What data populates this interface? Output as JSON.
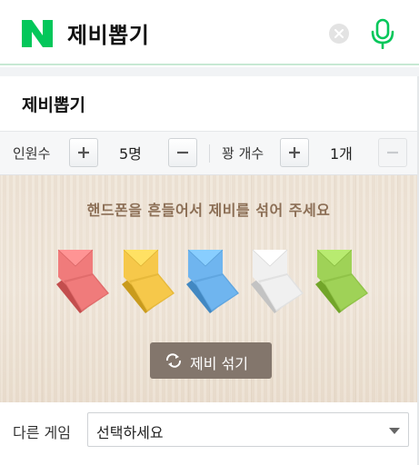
{
  "search": {
    "query": "제비뽑기",
    "logo_icon": "naver-n-logo",
    "logo_color": "#03c75a",
    "clear_icon": "clear-circle-icon",
    "mic_icon": "microphone-icon"
  },
  "widget": {
    "title": "제비뽑기",
    "participants": {
      "label": "인원수",
      "value": "5명"
    },
    "winners": {
      "label": "꽝 개수",
      "value": "1개"
    },
    "instruction": "핸드폰을 흔들어서 제비를 섞어 주세요",
    "tickets": [
      {
        "color": "#f07b7b"
      },
      {
        "color": "#f6c84a"
      },
      {
        "color": "#6fb5ef"
      },
      {
        "color": "#f0f0f0"
      },
      {
        "color": "#9fd257"
      }
    ],
    "shuffle": {
      "label": "제비 섞기",
      "icon": "shuffle-icon"
    },
    "other_game": {
      "label": "다른 게임",
      "selected": "선택하세요",
      "icon": "chevron-down-icon"
    }
  }
}
